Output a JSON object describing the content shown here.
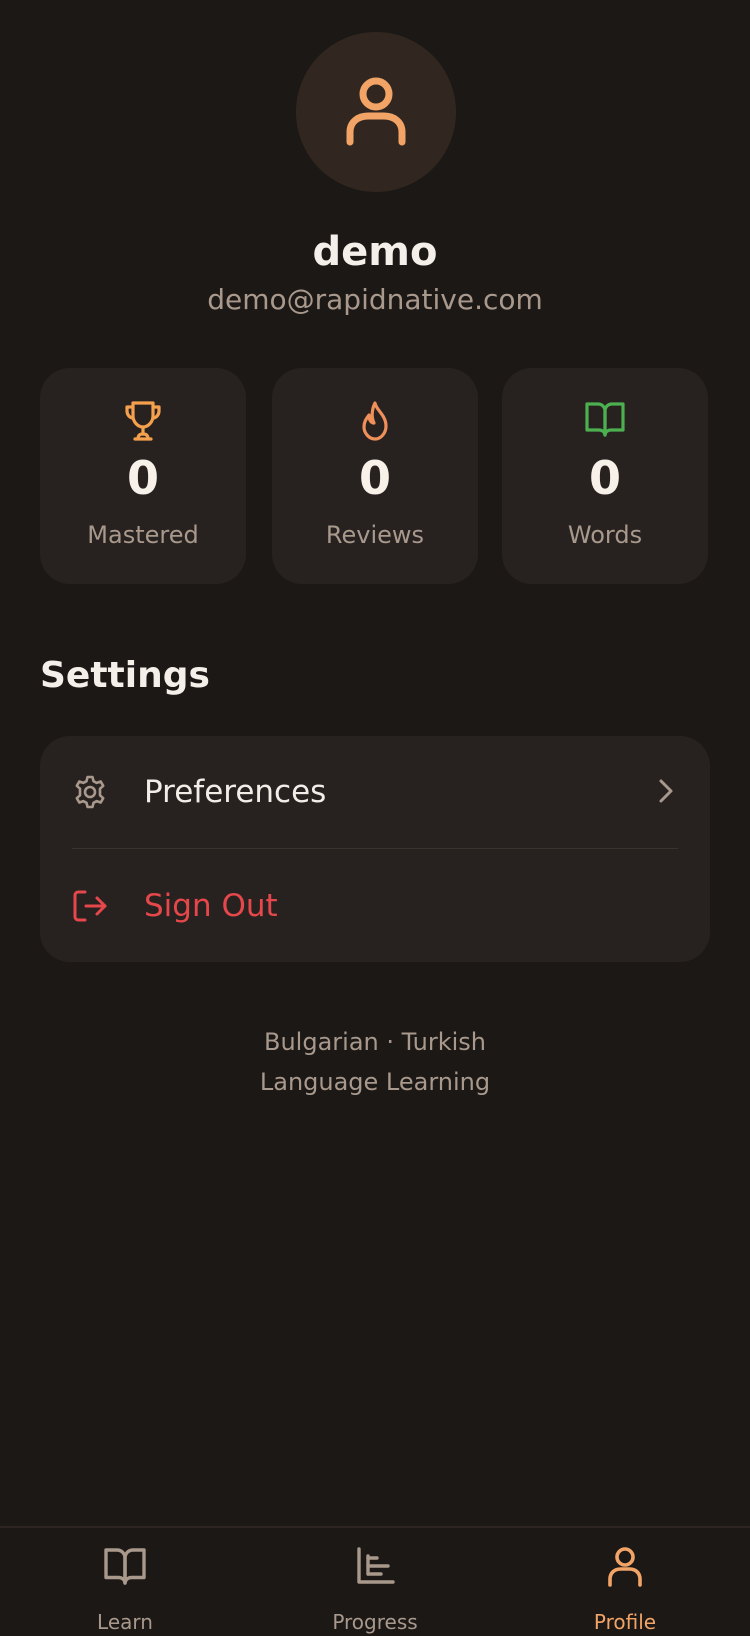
{
  "profile": {
    "name": "demo",
    "email": "demo@rapidnative.com",
    "avatar_icon": "user-icon"
  },
  "stats": [
    {
      "icon": "trophy-icon",
      "value": "0",
      "label": "Mastered",
      "color": "#f5a04d"
    },
    {
      "icon": "flame-icon",
      "value": "0",
      "label": "Reviews",
      "color": "#ef8f5a"
    },
    {
      "icon": "book-open-icon",
      "value": "0",
      "label": "Words",
      "color": "#4caf50"
    }
  ],
  "settings": {
    "heading": "Settings",
    "items": [
      {
        "label": "Preferences",
        "icon": "gear-icon",
        "color": "#f3ede7"
      },
      {
        "label": "Sign Out",
        "icon": "log-out-icon",
        "color": "#e5474b"
      }
    ]
  },
  "footer": {
    "line1": "Bulgarian · Turkish",
    "line2": "Language Learning"
  },
  "tabs": [
    {
      "label": "Learn",
      "icon": "book-open-icon",
      "active": false
    },
    {
      "label": "Progress",
      "icon": "bar-chart-icon",
      "active": false
    },
    {
      "label": "Profile",
      "icon": "user-icon",
      "active": true
    }
  ],
  "colors": {
    "background": "#1c1816",
    "card": "#272220",
    "accent": "#f5a04d",
    "muted": "#a8998c",
    "danger": "#e5474b"
  }
}
